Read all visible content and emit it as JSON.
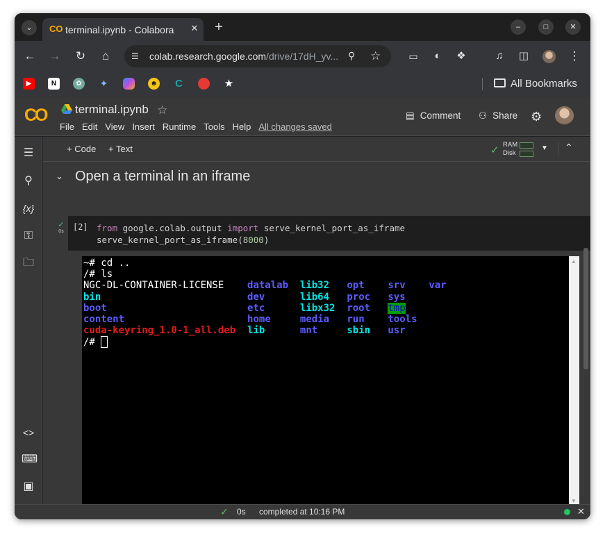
{
  "browser": {
    "tab": {
      "title": "terminal.ipynb - Colabora",
      "favicon": "colab-logo-icon"
    },
    "new_tab": "+",
    "window_controls": [
      "minimize",
      "maximize",
      "close"
    ],
    "address": {
      "host": "colab.research.google.com",
      "path": "/drive/17dH_yv..."
    },
    "bookmarks": {
      "items": [
        "youtube",
        "notion",
        "chatgpt",
        "gemini",
        "copilot",
        "claude",
        "cursor",
        "tomato",
        "star"
      ],
      "all_bookmarks_label": "All Bookmarks"
    }
  },
  "colab": {
    "notebook_title": "terminal.ipynb",
    "menu": [
      "File",
      "Edit",
      "View",
      "Insert",
      "Runtime",
      "Tools",
      "Help"
    ],
    "save_status": "All changes saved",
    "comment_label": "Comment",
    "share_label": "Share",
    "add_code_label": "Code",
    "add_text_label": "Text",
    "ram_label": "RAM",
    "disk_label": "Disk",
    "section_title": "Open a terminal in an iframe",
    "cell": {
      "exec_count": "[2]",
      "status_time": "0s",
      "line1": {
        "kw1": "from",
        "mod": " google.colab.output ",
        "kw2": "import",
        "name": " serve_kernel_port_as_iframe"
      },
      "line2": {
        "fn": "serve_kernel_port_as_iframe(",
        "arg": "8000",
        "close": ")"
      }
    },
    "terminal": {
      "prompt1": "~#",
      "cmd1": " cd ..",
      "prompt2": "/#",
      "cmd2": " ls",
      "ls_rows": [
        [
          "NGC-DL-CONTAINER-LICENSE",
          "datalab",
          "lib32",
          "opt",
          "srv",
          "var"
        ],
        [
          "bin",
          "dev",
          "lib64",
          "proc",
          "sys",
          ""
        ],
        [
          "boot",
          "etc",
          "libx32",
          "root",
          "tmp",
          ""
        ],
        [
          "content",
          "home",
          "media",
          "run",
          "tools",
          ""
        ],
        [
          "cuda-keyring_1.0-1_all.deb",
          "lib",
          "mnt",
          "sbin",
          "usr",
          ""
        ]
      ],
      "prompt3": "/#"
    },
    "statusbar": {
      "time": "0s",
      "message": "completed at 10:16 PM"
    }
  },
  "colors": {
    "accent_green": "#5bb974",
    "colab_orange": "#f9ab00",
    "terminal_dir": "#5c5cff",
    "terminal_link": "#00e5e5",
    "terminal_archive": "#e01b1b"
  }
}
